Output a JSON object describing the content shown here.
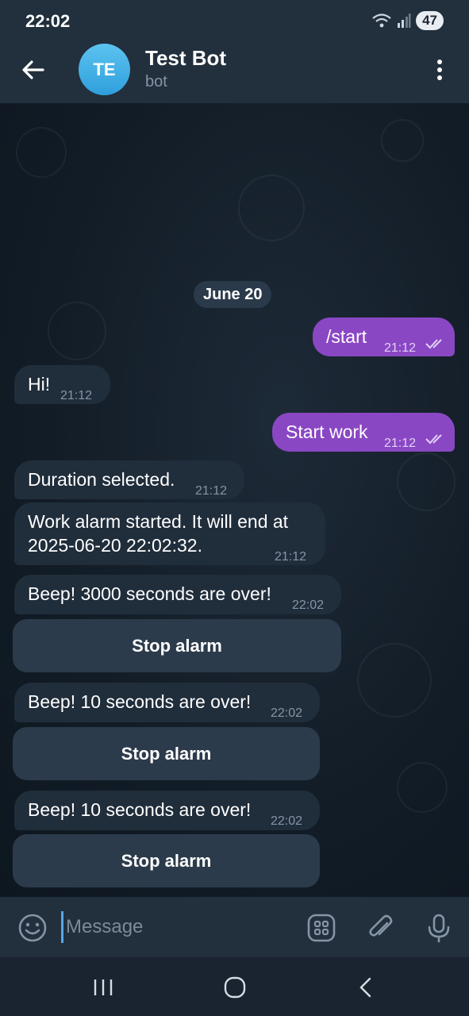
{
  "status_bar": {
    "time": "22:02",
    "battery": "47",
    "icons": [
      "wifi-icon",
      "signal-icon"
    ]
  },
  "header": {
    "avatar_initials": "TE",
    "title": "Test Bot",
    "subtitle": "bot",
    "back_icon": "arrow-left-icon",
    "menu_icon": "more-vertical-icon"
  },
  "chat": {
    "date": "June 20",
    "messages": [
      {
        "dir": "out",
        "text": "/start",
        "time": "21:12",
        "read": true
      },
      {
        "dir": "in",
        "text": "Hi!",
        "time": "21:12"
      },
      {
        "dir": "out",
        "text": "Start work",
        "time": "21:12",
        "read": true
      },
      {
        "dir": "in",
        "text": "Duration selected.",
        "time": "21:12"
      },
      {
        "dir": "in",
        "text_line1": "Work alarm started. It will end at",
        "text_line2": "2025-06-20 22:02:32.",
        "time": "21:12"
      },
      {
        "dir": "in",
        "text": "Beep! 3000 seconds are over!",
        "time": "22:02",
        "button": "Stop alarm"
      },
      {
        "dir": "in",
        "text": "Beep! 10 seconds are over!",
        "time": "22:02",
        "button": "Stop alarm"
      },
      {
        "dir": "in",
        "text": "Beep! 10 seconds are over!",
        "time": "22:02",
        "button": "Stop alarm"
      }
    ]
  },
  "input": {
    "placeholder": "Message",
    "icons": [
      "emoji-icon",
      "bot-commands-icon",
      "attach-icon",
      "microphone-icon"
    ]
  },
  "nav_bar": {
    "icons": [
      "recent-apps-icon",
      "home-icon",
      "back-icon"
    ]
  },
  "colors": {
    "outgoing_bubble": "#8a47c4",
    "incoming_bubble": "#202d3b",
    "header_bg": "#222f3d",
    "accent": "#58a6e6"
  }
}
